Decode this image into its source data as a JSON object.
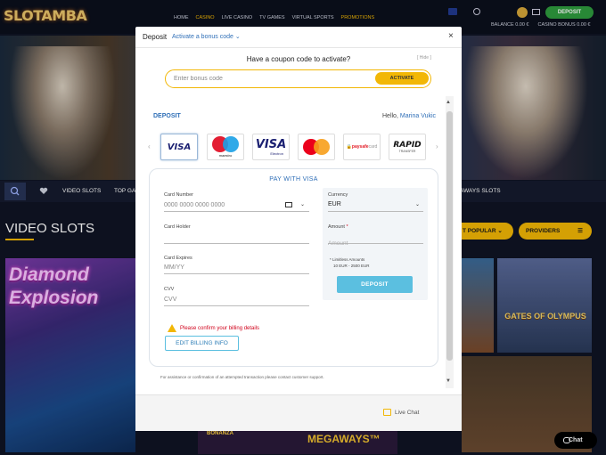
{
  "site": {
    "logo": "SLOTAMBA",
    "nav": [
      {
        "label": "HOME",
        "state": ""
      },
      {
        "label": "CASINO",
        "state": "active"
      },
      {
        "label": "LIVE CASINO",
        "state": ""
      },
      {
        "label": "TV GAMES",
        "state": ""
      },
      {
        "label": "VIRTUAL SPORTS",
        "state": ""
      },
      {
        "label": "PROMOTIONS",
        "state": "promo"
      }
    ],
    "deposit_label": "DEPOSIT",
    "balance": "BALANCE  0.00 €",
    "casino_bonus": "CASINO BONUS  0.00 €",
    "categories": {
      "video_slots": "VIDEO SLOTS",
      "top": "TOP GA",
      "megaways": "AWAYS SLOTS"
    },
    "page_title": "VIDEO SLOTS",
    "sort_label": "T POPULAR",
    "providers_label": "PROVIDERS",
    "tiles": {
      "diamond": "Diamond Explosion",
      "megaways": "MEGAWAYS™",
      "bonanza": "BONANZA",
      "olympus": "GATES OF OLYMPUS"
    },
    "chat_label": "Chat",
    "accent": "#f2b705"
  },
  "modal": {
    "title": "Deposit",
    "bonus_link": "Activate a bonus code",
    "coupon_question": "Have a coupon code to activate?",
    "hide_label": "[ Hide ]",
    "coupon_placeholder": "Enter bonus code",
    "activate_label": "ACTIVATE",
    "section_title": "DEPOSIT",
    "hello_prefix": "Hello,",
    "user_name": "Marina Vukic",
    "payment_methods": [
      "VISA",
      "maestro",
      "VISA Electron",
      "mastercard",
      "paysafecard",
      "RAPID"
    ],
    "pay_with": "PAY WITH VISA",
    "card_number_label": "Card Number",
    "card_number_placeholder": "0000 0000 0000 0000",
    "card_holder_label": "Card Holder",
    "card_expires_label": "Card Expires",
    "card_expires_placeholder": "MM/YY",
    "cvv_label": "CVV",
    "cvv_placeholder": "CVV",
    "currency_label": "Currency",
    "currency_value": "EUR",
    "amount_label": "Amount",
    "amount_required": "*",
    "amount_placeholder": "Amount",
    "limits_title": "* Limitless Amounts",
    "limits_range": "10 EUR - 2500 EUR",
    "deposit_button": "DEPOSIT",
    "billing_warning": "Please confirm your billing details",
    "edit_billing": "EDIT BILLING INFO",
    "assist_text": "For assistance or confirmation of an attempted transaction please contact customer support.",
    "live_chat": "Live Chat",
    "link_color": "#2f6fb7",
    "button_color": "#5bbfe0"
  }
}
